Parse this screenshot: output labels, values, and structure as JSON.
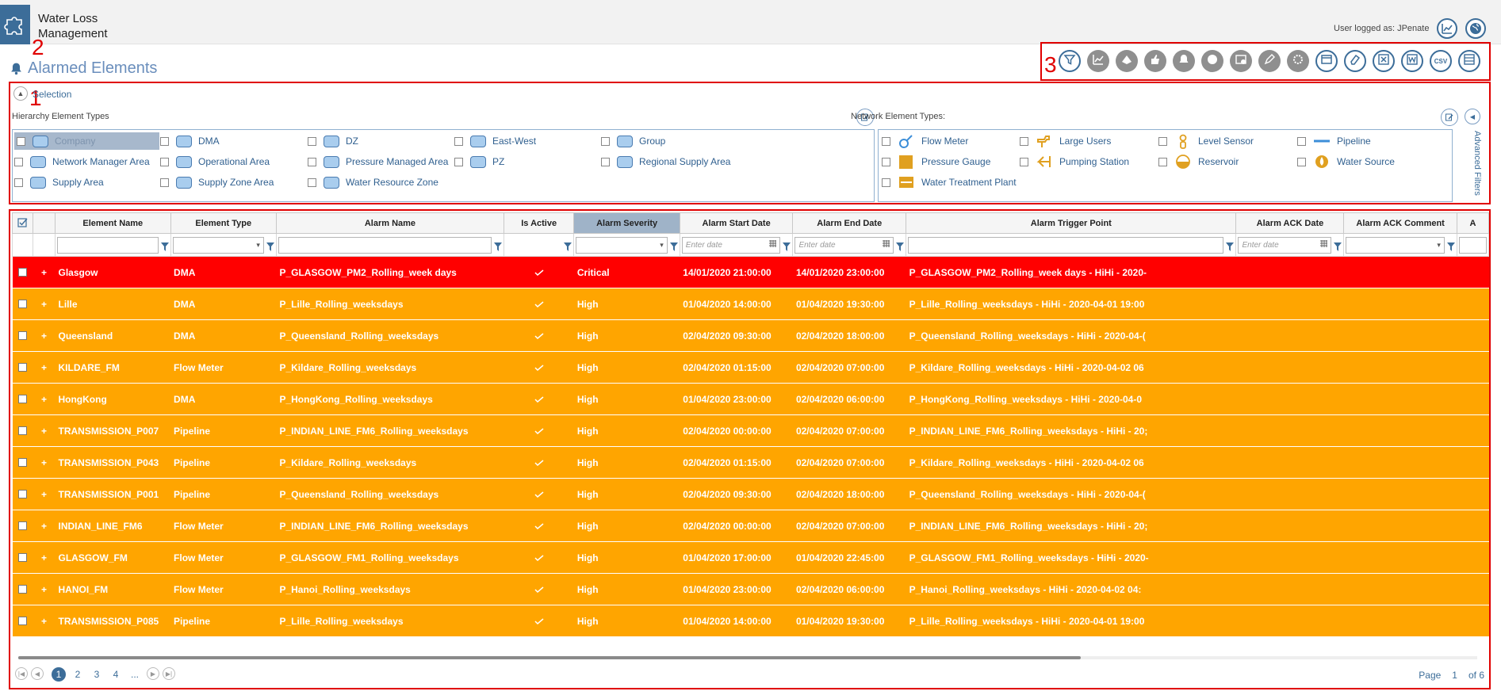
{
  "app": {
    "title": "Water Loss\nManagement",
    "user_label": "User logged as: JPenate",
    "page_title": "Alarmed Elements"
  },
  "markers": [
    "1",
    "2",
    "3"
  ],
  "toolbar": {
    "buttons": [
      {
        "icon": "filter-icon",
        "state": "active"
      },
      {
        "icon": "trend-chart-icon",
        "state": "disabled"
      },
      {
        "icon": "map-view-icon",
        "state": "disabled"
      },
      {
        "icon": "thumbs-up-icon",
        "state": "disabled"
      },
      {
        "icon": "bell-icon",
        "state": "disabled"
      },
      {
        "icon": "globe-icon",
        "state": "disabled"
      },
      {
        "icon": "clear-alarm-icon",
        "state": "disabled"
      },
      {
        "icon": "edit-icon",
        "state": "disabled"
      },
      {
        "icon": "settings-icon",
        "state": "disabled"
      },
      {
        "icon": "window-icon",
        "state": "active"
      },
      {
        "icon": "eraser-icon",
        "state": "active"
      },
      {
        "icon": "excel-export-icon",
        "state": "active"
      },
      {
        "icon": "word-export-icon",
        "state": "active"
      },
      {
        "icon": "csv-export-icon",
        "state": "active",
        "label": "CSV"
      },
      {
        "icon": "columns-icon",
        "state": "active"
      }
    ]
  },
  "selection": {
    "label": "Selection",
    "hierarchy_label": "Hierarchy Element Types",
    "network_label": "Network Element Types:",
    "advanced_filters": "Advanced Filters",
    "hierarchy_types": [
      {
        "label": "Company",
        "selected": true
      },
      {
        "label": "DMA"
      },
      {
        "label": "DZ"
      },
      {
        "label": "East-West"
      },
      {
        "label": "Group"
      },
      {
        "label": "Network Manager Area"
      },
      {
        "label": "Operational Area"
      },
      {
        "label": "Pressure Managed Area"
      },
      {
        "label": "PZ"
      },
      {
        "label": "Regional Supply Area"
      },
      {
        "label": "Supply Area"
      },
      {
        "label": "Supply Zone Area"
      },
      {
        "label": "Water Resource Zone"
      }
    ],
    "network_types": [
      {
        "label": "Flow Meter",
        "icon": "flow-meter-icon"
      },
      {
        "label": "Large Users",
        "icon": "large-users-icon"
      },
      {
        "label": "Level Sensor",
        "icon": "level-sensor-icon"
      },
      {
        "label": "Pipeline",
        "icon": "pipeline-icon"
      },
      {
        "label": "Pressure Gauge",
        "icon": "pressure-gauge-icon"
      },
      {
        "label": "Pumping Station",
        "icon": "pumping-station-icon"
      },
      {
        "label": "Reservoir",
        "icon": "reservoir-icon"
      },
      {
        "label": "Water Source",
        "icon": "water-source-icon"
      },
      {
        "label": "Water Treatment Plant",
        "icon": "water-treatment-plant-icon"
      }
    ]
  },
  "grid": {
    "columns": [
      "",
      "",
      "Element Name",
      "Element Type",
      "Alarm Name",
      "Is Active",
      "Alarm Severity",
      "Alarm Start Date",
      "Alarm End Date",
      "Alarm Trigger Point",
      "Alarm ACK Date",
      "Alarm ACK Comment",
      "A"
    ],
    "sorted_column": "Alarm Severity",
    "date_placeholder": "Enter date",
    "rows": [
      {
        "name": "Glasgow",
        "type": "DMA",
        "alarm": "P_GLASGOW_PM2_Rolling_week days",
        "severity": "Critical",
        "start": "14/01/2020 21:00:00",
        "end": "14/01/2020 23:00:00",
        "trigger": "P_GLASGOW_PM2_Rolling_week days - HiHi - 2020-"
      },
      {
        "name": "Lille",
        "type": "DMA",
        "alarm": "P_Lille_Rolling_weeksdays",
        "severity": "High",
        "start": "01/04/2020 14:00:00",
        "end": "01/04/2020 19:30:00",
        "trigger": "P_Lille_Rolling_weeksdays - HiHi - 2020-04-01 19:00"
      },
      {
        "name": "Queensland",
        "type": "DMA",
        "alarm": "P_Queensland_Rolling_weeksdays",
        "severity": "High",
        "start": "02/04/2020 09:30:00",
        "end": "02/04/2020 18:00:00",
        "trigger": "P_Queensland_Rolling_weeksdays - HiHi - 2020-04-("
      },
      {
        "name": "KILDARE_FM",
        "type": "Flow Meter",
        "alarm": "P_Kildare_Rolling_weeksdays",
        "severity": "High",
        "start": "02/04/2020 01:15:00",
        "end": "02/04/2020 07:00:00",
        "trigger": "P_Kildare_Rolling_weeksdays - HiHi - 2020-04-02 06"
      },
      {
        "name": "HongKong",
        "type": "DMA",
        "alarm": "P_HongKong_Rolling_weeksdays",
        "severity": "High",
        "start": "01/04/2020 23:00:00",
        "end": "02/04/2020 06:00:00",
        "trigger": "P_HongKong_Rolling_weeksdays - HiHi - 2020-04-0"
      },
      {
        "name": "TRANSMISSION_P007",
        "type": "Pipeline",
        "alarm": "P_INDIAN_LINE_FM6_Rolling_weeksdays",
        "severity": "High",
        "start": "02/04/2020 00:00:00",
        "end": "02/04/2020 07:00:00",
        "trigger": "P_INDIAN_LINE_FM6_Rolling_weeksdays - HiHi - 20;"
      },
      {
        "name": "TRANSMISSION_P043",
        "type": "Pipeline",
        "alarm": "P_Kildare_Rolling_weeksdays",
        "severity": "High",
        "start": "02/04/2020 01:15:00",
        "end": "02/04/2020 07:00:00",
        "trigger": "P_Kildare_Rolling_weeksdays - HiHi - 2020-04-02 06"
      },
      {
        "name": "TRANSMISSION_P001",
        "type": "Pipeline",
        "alarm": "P_Queensland_Rolling_weeksdays",
        "severity": "High",
        "start": "02/04/2020 09:30:00",
        "end": "02/04/2020 18:00:00",
        "trigger": "P_Queensland_Rolling_weeksdays - HiHi - 2020-04-("
      },
      {
        "name": "INDIAN_LINE_FM6",
        "type": "Flow Meter",
        "alarm": "P_INDIAN_LINE_FM6_Rolling_weeksdays",
        "severity": "High",
        "start": "02/04/2020 00:00:00",
        "end": "02/04/2020 07:00:00",
        "trigger": "P_INDIAN_LINE_FM6_Rolling_weeksdays - HiHi - 20;"
      },
      {
        "name": "GLASGOW_FM",
        "type": "Flow Meter",
        "alarm": "P_GLASGOW_FM1_Rolling_weeksdays",
        "severity": "High",
        "start": "01/04/2020 17:00:00",
        "end": "01/04/2020 22:45:00",
        "trigger": "P_GLASGOW_FM1_Rolling_weeksdays - HiHi - 2020-"
      },
      {
        "name": "HANOI_FM",
        "type": "Flow Meter",
        "alarm": "P_Hanoi_Rolling_weeksdays",
        "severity": "High",
        "start": "01/04/2020 23:00:00",
        "end": "02/04/2020 06:00:00",
        "trigger": "P_Hanoi_Rolling_weeksdays - HiHi - 2020-04-02 04:"
      },
      {
        "name": "TRANSMISSION_P085",
        "type": "Pipeline",
        "alarm": "P_Lille_Rolling_weeksdays",
        "severity": "High",
        "start": "01/04/2020 14:00:00",
        "end": "01/04/2020 19:30:00",
        "trigger": "P_Lille_Rolling_weeksdays - HiHi - 2020-04-01 19:00"
      }
    ]
  },
  "pager": {
    "pages": [
      "1",
      "2",
      "3",
      "4",
      "..."
    ],
    "current": "1",
    "page_label": "Page",
    "page_value": "1",
    "of_label": "of 6"
  },
  "colors": {
    "brand": "#3c6d99",
    "critical": "#ff0000",
    "high": "#ffa500",
    "annotation": "#e00000"
  }
}
